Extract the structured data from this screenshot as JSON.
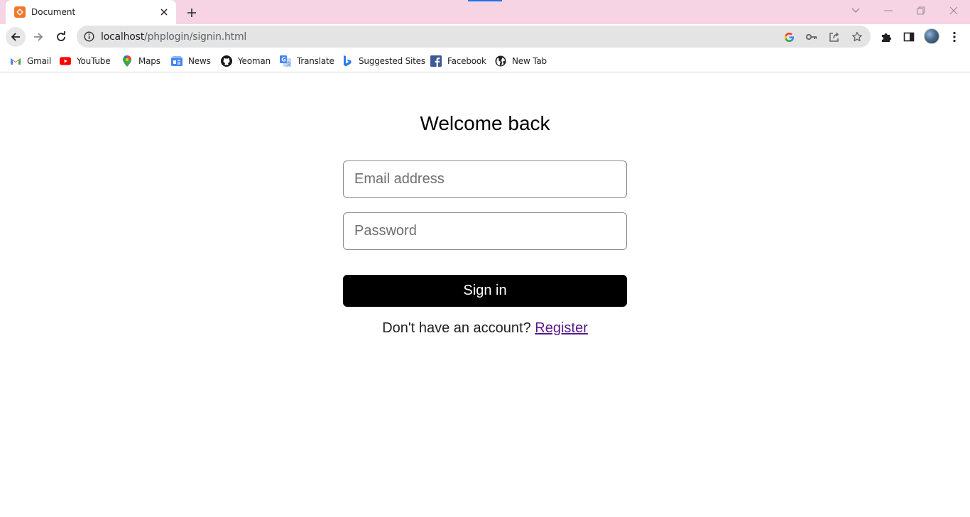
{
  "browser": {
    "tab": {
      "title": "Document"
    },
    "address_bar": {
      "host": "localhost",
      "path": "/phplogin/signin.html"
    },
    "bookmarks": [
      {
        "label": "Gmail",
        "icon": "gmail-icon"
      },
      {
        "label": "YouTube",
        "icon": "youtube-icon"
      },
      {
        "label": "Maps",
        "icon": "maps-icon"
      },
      {
        "label": "News",
        "icon": "news-icon"
      },
      {
        "label": "Yeoman",
        "icon": "github-icon"
      },
      {
        "label": "Translate",
        "icon": "translate-icon"
      },
      {
        "label": "Suggested Sites",
        "icon": "bing-icon"
      },
      {
        "label": "Facebook",
        "icon": "facebook-icon"
      },
      {
        "label": "New Tab",
        "icon": "globe-icon"
      }
    ]
  },
  "page": {
    "heading": "Welcome back",
    "email_placeholder": "Email address",
    "password_placeholder": "Password",
    "signin_label": "Sign in",
    "register_prompt": "Don't have an account?",
    "register_link": "Register"
  },
  "colors": {
    "tabstrip": "#f6d4e3",
    "button": "#000000",
    "link_visited": "#551a8b"
  }
}
